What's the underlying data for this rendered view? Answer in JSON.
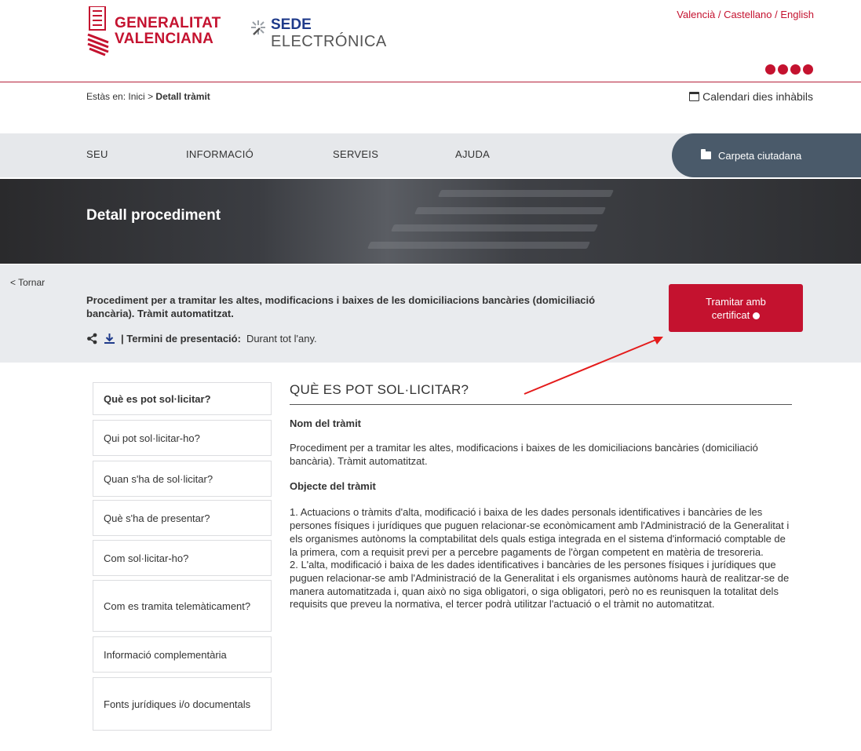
{
  "header": {
    "gv_line1": "GENERALITAT",
    "gv_line2": "VALENCIANA",
    "sede_line1": "SEDE",
    "sede_line2": "ELECTRÓNICA",
    "languages": [
      "Valencià",
      "Castellano",
      "English"
    ],
    "lang_separator": " / ",
    "social_icons": [
      "facebook-icon",
      "youtube-icon",
      "instagram-icon",
      "twitter-icon"
    ],
    "brand_color": "#c4122f"
  },
  "breadcrumb": {
    "prefix": "Estàs en:",
    "home": "Inici",
    "separator": ">",
    "current": "Detall tràmit"
  },
  "calendar_link": "Calendari dies inhàbils",
  "nav": {
    "items": [
      "SEU",
      "INFORMACIÓ",
      "SERVEIS",
      "AJUDA"
    ],
    "carpeta": "Carpeta ciutadana"
  },
  "banner": {
    "title": "Detall procediment"
  },
  "procedure": {
    "back": "< Tornar",
    "title": "Procediment per a tramitar les altes, modificacions i baixes de les domiciliacions bancàries (domiciliació bancària). Tràmit automatitzat.",
    "deadline_label": "| Termini de presentació:",
    "deadline_value": "Durant tot l'any.",
    "button_line1": "Tramitar amb",
    "button_line2": "certificat"
  },
  "side_menu": [
    "Què es pot sol·licitar?",
    "Qui pot sol·licitar-ho?",
    "Quan s'ha de sol·licitar?",
    "Què s'ha de presentar?",
    "Com sol·licitar-ho?",
    "Com es tramita telemàticament?",
    "Informació complementària",
    "Fonts jurídiques i/o documentals"
  ],
  "content": {
    "section_title": "QUÈ ES POT SOL·LICITAR?",
    "name_label": "Nom del tràmit",
    "name_text": "Procediment per a tramitar les altes, modificacions i baixes de les domiciliacions bancàries (domiciliació bancària). Tràmit automatitzat.",
    "object_label": "Objecte del tràmit",
    "object_p1": "1. Actuacions o tràmits d'alta, modificació i baixa de les dades personals identificatives i bancàries de les persones físiques i jurídiques que puguen relacionar-se econòmicament amb l'Administració de la Generalitat i els organismes autònoms la comptabilitat dels quals estiga integrada en el sistema d'informació comptable de la primera, com a requisit previ per a percebre pagaments de l'òrgan competent en matèria de tresoreria.",
    "object_p2": "2. L'alta, modificació i baixa de les dades identificatives i bancàries de les persones físiques i jurídiques que puguen relacionar-se amb l'Administració de la Generalitat i els organismes autònoms haurà de realitzar-se de manera automatitzada i, quan això no siga obligatori, o siga obligatori, però no es reunisquen la totalitat dels requisits que preveu la normativa, el tercer podrà utilitzar l'actuació o el tràmit no automatitzat."
  }
}
